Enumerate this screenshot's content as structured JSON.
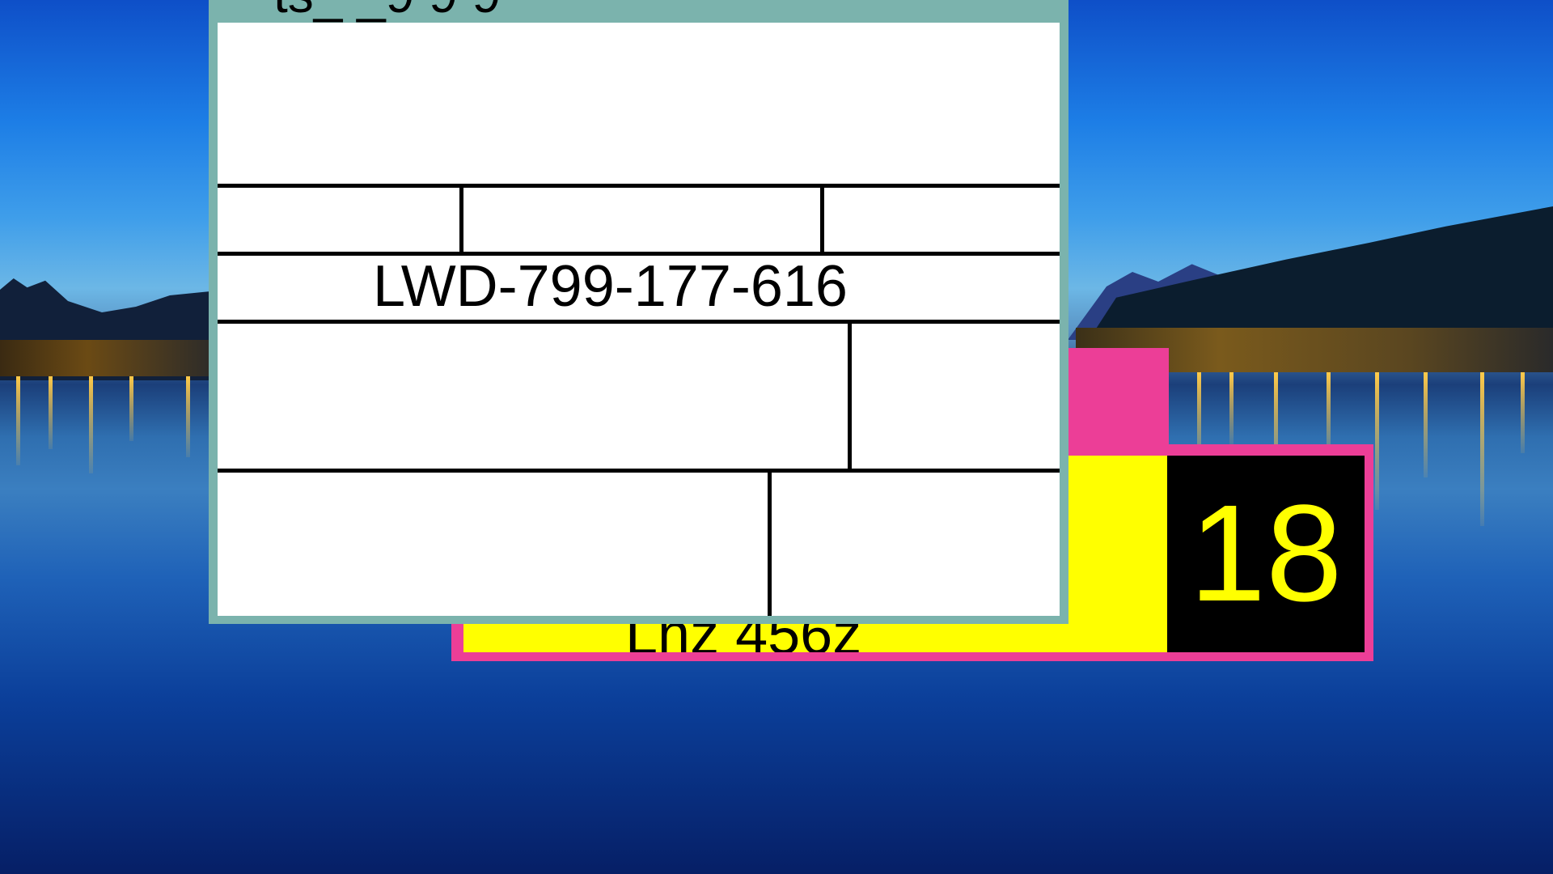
{
  "desktop": {
    "wallpaper": "lake-night-cityscape"
  },
  "form_window": {
    "title_fragment": "ts_    _9 9 9",
    "record_id": "LWD-799-177-616",
    "border_color": "#7bb3ad"
  },
  "tag_window": {
    "label_fragment": "Lnz    456z",
    "count": "18",
    "frame_color": "#ec3e97",
    "label_bg": "#ffff00",
    "count_bg": "#000000",
    "count_color": "#ffff00"
  }
}
